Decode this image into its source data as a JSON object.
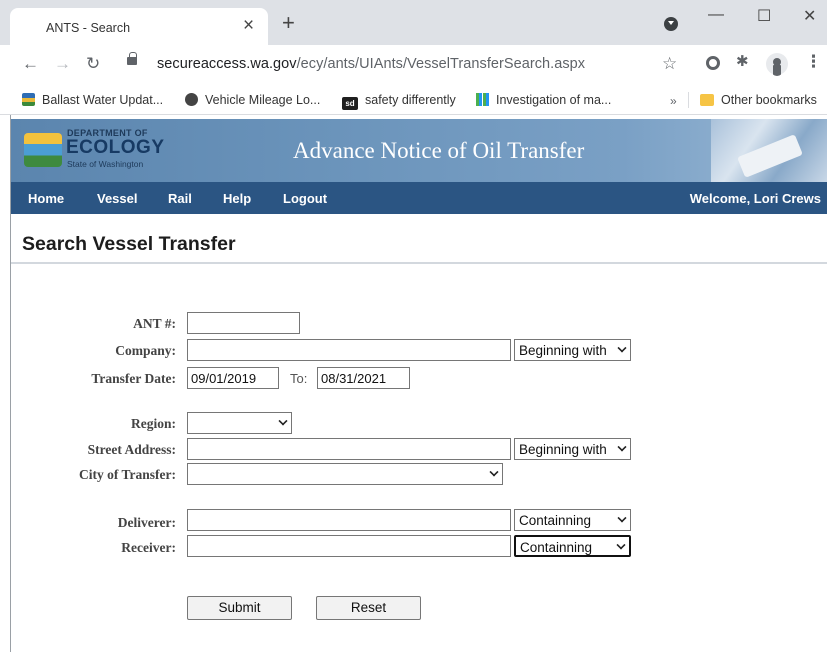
{
  "browser": {
    "tab_title": "ANTS - Search",
    "tab_close": "×",
    "new_tab": "+",
    "url_host": "secureaccess.wa.gov",
    "url_path": "/ecy/ants/UIAnts/VesselTransferSearch.aspx",
    "window_controls": {
      "minimize": "—",
      "maximize": "☐",
      "close": "✕"
    },
    "bookmarks": [
      {
        "label": "Ballast Water Updat...",
        "icon": "ballast-icon"
      },
      {
        "label": "Vehicle Mileage Lo...",
        "icon": "globe-icon"
      },
      {
        "label": "safety differently",
        "icon": "sd-icon",
        "icon_text": "sd"
      },
      {
        "label": "Investigation of ma...",
        "icon": "grid-icon"
      }
    ],
    "bookmarks_more": "»",
    "other_bookmarks": "Other bookmarks"
  },
  "header": {
    "logo_dept": "DEPARTMENT OF",
    "logo_name": "ECOLOGY",
    "logo_state": "State of Washington",
    "title": "Advance Notice of Oil Transfer"
  },
  "nav": {
    "items": [
      "Home",
      "Vessel",
      "Rail",
      "Help",
      "Logout"
    ],
    "welcome": "Welcome, Lori Crews"
  },
  "page": {
    "title": "Search Vessel Transfer"
  },
  "form": {
    "ant_label": "ANT #:",
    "ant_value": "",
    "company_label": "Company:",
    "company_value": "",
    "company_match": "Beginning with",
    "transfer_date_label": "Transfer Date:",
    "date_from": "09/01/2019",
    "to_label": "To:",
    "date_to": "08/31/2021",
    "region_label": "Region:",
    "region_value": "",
    "street_label": "Street Address:",
    "street_value": "",
    "street_match": "Beginning with",
    "city_label": "City of Transfer:",
    "city_value": "",
    "deliverer_label": "Deliverer:",
    "deliverer_value": "",
    "deliverer_match": "Containning",
    "receiver_label": "Receiver:",
    "receiver_value": "",
    "receiver_match": "Containning",
    "submit": "Submit",
    "reset": "Reset"
  }
}
